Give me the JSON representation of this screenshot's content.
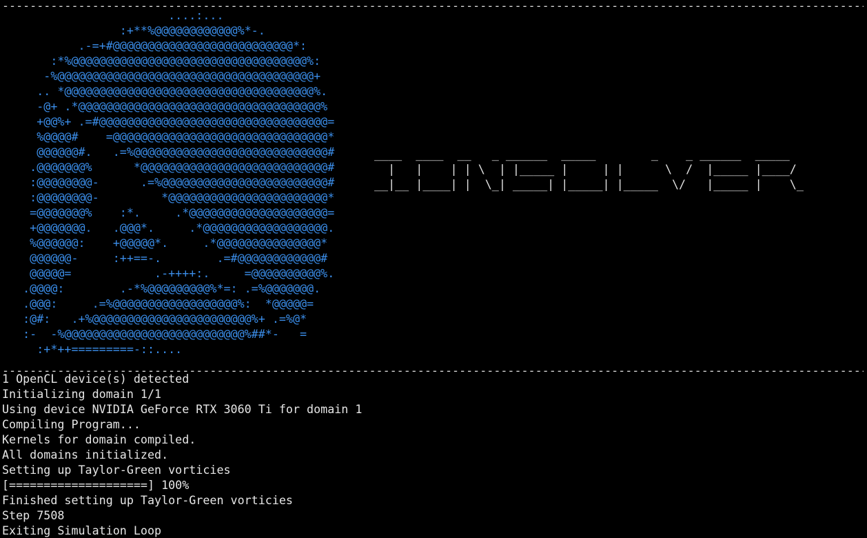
{
  "colors": {
    "background": "#000000",
    "logo": "#3b8eea",
    "text": "#e6e6e6"
  },
  "separator": "--------------------------------------------------------------------------------------------------------------------------------------------------------------------------------------------------------------------------------",
  "logo_art": [
    "                        ....:...",
    "                 :+**%@@@@@@@@@@@@%*-.",
    "           .-=+#@@@@@@@@@@@@@@@@@@@@@@@@@@*:",
    "       :*%@@@@@@@@@@@@@@@@@@@@@@@@@@@@@@@@@@%:",
    "      -%@@@@@@@@@@@@@@@@@@@@@@@@@@@@@@@@@@@@@+",
    "     .. *@@@@@@@@@@@@@@@@@@@@@@@@@@@@@@@@@@@@%.",
    "     -@+ .*@@@@@@@@@@@@@@@@@@@@@@@@@@@@@@@@@@@%",
    "     +@@%+ .=#@@@@@@@@@@@@@@@@@@@@@@@@@@@@@@@@@=",
    "     %@@@@#    =@@@@@@@@@@@@@@@@@@@@@@@@@@@@@@@*",
    "     @@@@@@#.   .=%@@@@@@@@@@@@@@@@@@@@@@@@@@@@#",
    "    .@@@@@@@%      *@@@@@@@@@@@@@@@@@@@@@@@@@@@#",
    "    :@@@@@@@@-      .=%@@@@@@@@@@@@@@@@@@@@@@@@#",
    "    :@@@@@@@@-         *@@@@@@@@@@@@@@@@@@@@@@@*",
    "    =@@@@@@@%    :*.     .*@@@@@@@@@@@@@@@@@@@@=",
    "    +@@@@@@@.   .@@@*.     .*@@@@@@@@@@@@@@@@@@.",
    "    %@@@@@@:    +@@@@@*.     .*@@@@@@@@@@@@@@@*",
    "    @@@@@@-     :++==-.        .=#@@@@@@@@@@@@#",
    "    @@@@@=            .-++++:.     =@@@@@@@@@@%.",
    "   .@@@@:        .-*%@@@@@@@@@%*=: .=%@@@@@@@.",
    "   .@@@:     .=%@@@@@@@@@@@@@@@@@@%:  *@@@@@=",
    "   :@#:   .+%@@@@@@@@@@@@@@@@@@@@@@@%+ .=%@*",
    "   :-  -%@@@@@@@@@@@@@@@@@@@@@@@@@@%##*-   =",
    "     :+*++=========-::...."
  ],
  "banner_art": [
    "____  ____  __   _ ______  _____        _    _ ______  _____",
    "  |   |    | | \\  | |_____ |     | |      \\  /  |_____ |____/",
    "__|__ |____| |  \\_| _____| |_____| |_____  \\/   |_____ |    \\_"
  ],
  "output_lines": [
    "1 OpenCL device(s) detected",
    "Initializing domain 1/1",
    "Using device NVIDIA GeForce RTX 3060 Ti for domain 1",
    "Compiling Program...",
    "Kernels for domain compiled.",
    "All domains initialized.",
    "Setting up Taylor-Green vorticies",
    "[====================] 100%",
    "Finished setting up Taylor-Green vorticies",
    "Step 7508",
    "Exiting Simulation Loop"
  ]
}
